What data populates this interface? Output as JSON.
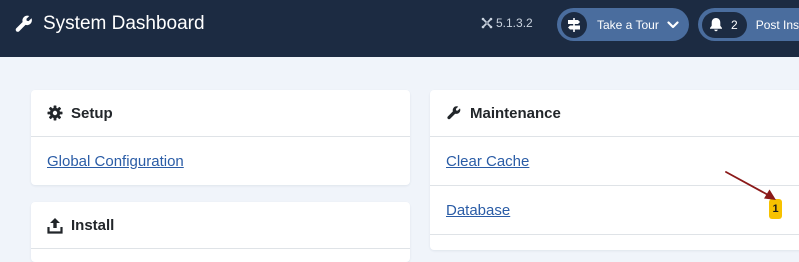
{
  "header": {
    "title": "System Dashboard",
    "title_icon": "wrench-icon",
    "version": "5.1.3.2",
    "version_icon": "joomla-icon",
    "tour_button": {
      "label": "Take a Tour",
      "icon": "signpost-icon",
      "chevron": "chevron-down-icon"
    },
    "post_install_button": {
      "count": "2",
      "label": "Post Inst",
      "icon": "bell-icon"
    },
    "background_color": "#1c2b42",
    "pill_color": "#4a6d9e"
  },
  "cards": {
    "setup": {
      "title": "Setup",
      "icon": "gear-icon",
      "links": [
        {
          "label": "Global Configuration"
        }
      ]
    },
    "install": {
      "title": "Install",
      "icon": "upload-icon"
    },
    "maintenance": {
      "title": "Maintenance",
      "icon": "wrench-icon",
      "links": [
        {
          "label": "Clear Cache"
        },
        {
          "label": "Database",
          "badge": "1"
        }
      ]
    }
  },
  "annotation": {
    "arrow_color": "#8b1a1a",
    "badge_color": "#f7c200",
    "link_color": "#2a5ca6"
  }
}
